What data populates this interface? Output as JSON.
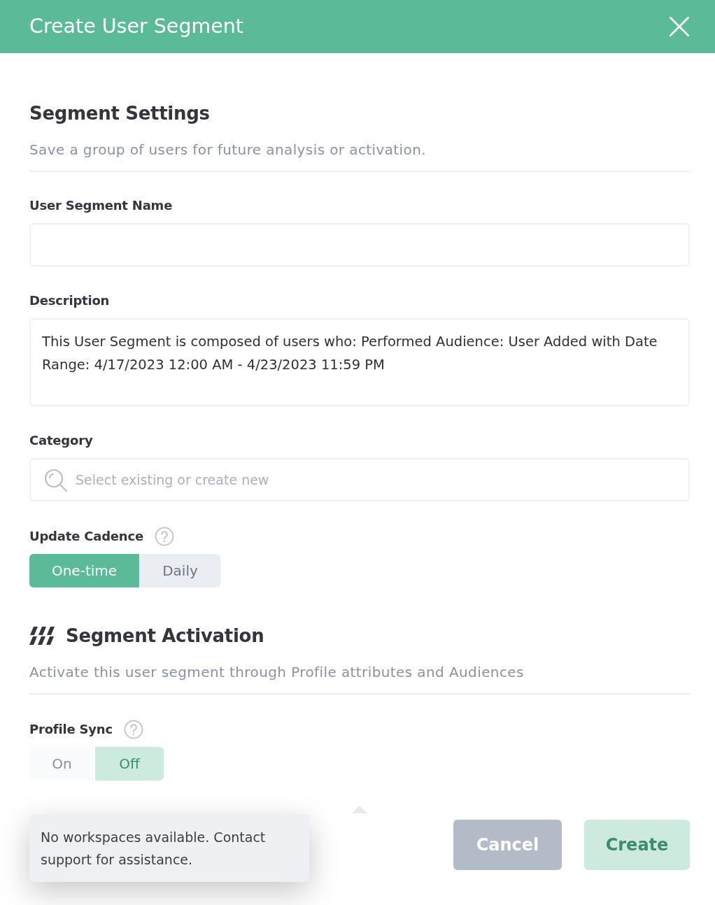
{
  "dialog": {
    "title": "Create User Segment"
  },
  "settings": {
    "heading": "Segment Settings",
    "subtitle": "Save a group of users for future analysis or activation."
  },
  "fields": [
    {
      "kind": "input",
      "label": "User Segment Name"
    },
    {
      "kind": "textarea",
      "label": "Description",
      "value": "This User Segment is composed of users who: Performed Audience: User Added with Date Range: 4/17/2023 12:00 AM - 4/23/2023 11:59 PM"
    },
    {
      "kind": "search",
      "label": "Category",
      "placeholder": "Select existing or create new"
    }
  ],
  "cadence": {
    "label": "Update Cadence",
    "options": [
      {
        "label": "One-time",
        "selected": true,
        "disabled": false
      },
      {
        "label": "Daily",
        "selected": false,
        "disabled": false
      }
    ]
  },
  "activation": {
    "heading": "Segment Activation",
    "subtitle": "Activate this user segment through Profile attributes and Audiences"
  },
  "profile_sync": {
    "label": "Profile Sync",
    "options": [
      {
        "label": "On",
        "selected": false,
        "disabled": true
      },
      {
        "label": "Off",
        "selected": true,
        "disabled": true
      }
    ]
  },
  "tooltip": {
    "text": "No workspaces available. Contact support for assistance."
  },
  "buttons": [
    {
      "label": "Cancel",
      "kind": "secondary",
      "disabled": false
    },
    {
      "label": "Create",
      "kind": "primary",
      "disabled": true
    }
  ]
}
